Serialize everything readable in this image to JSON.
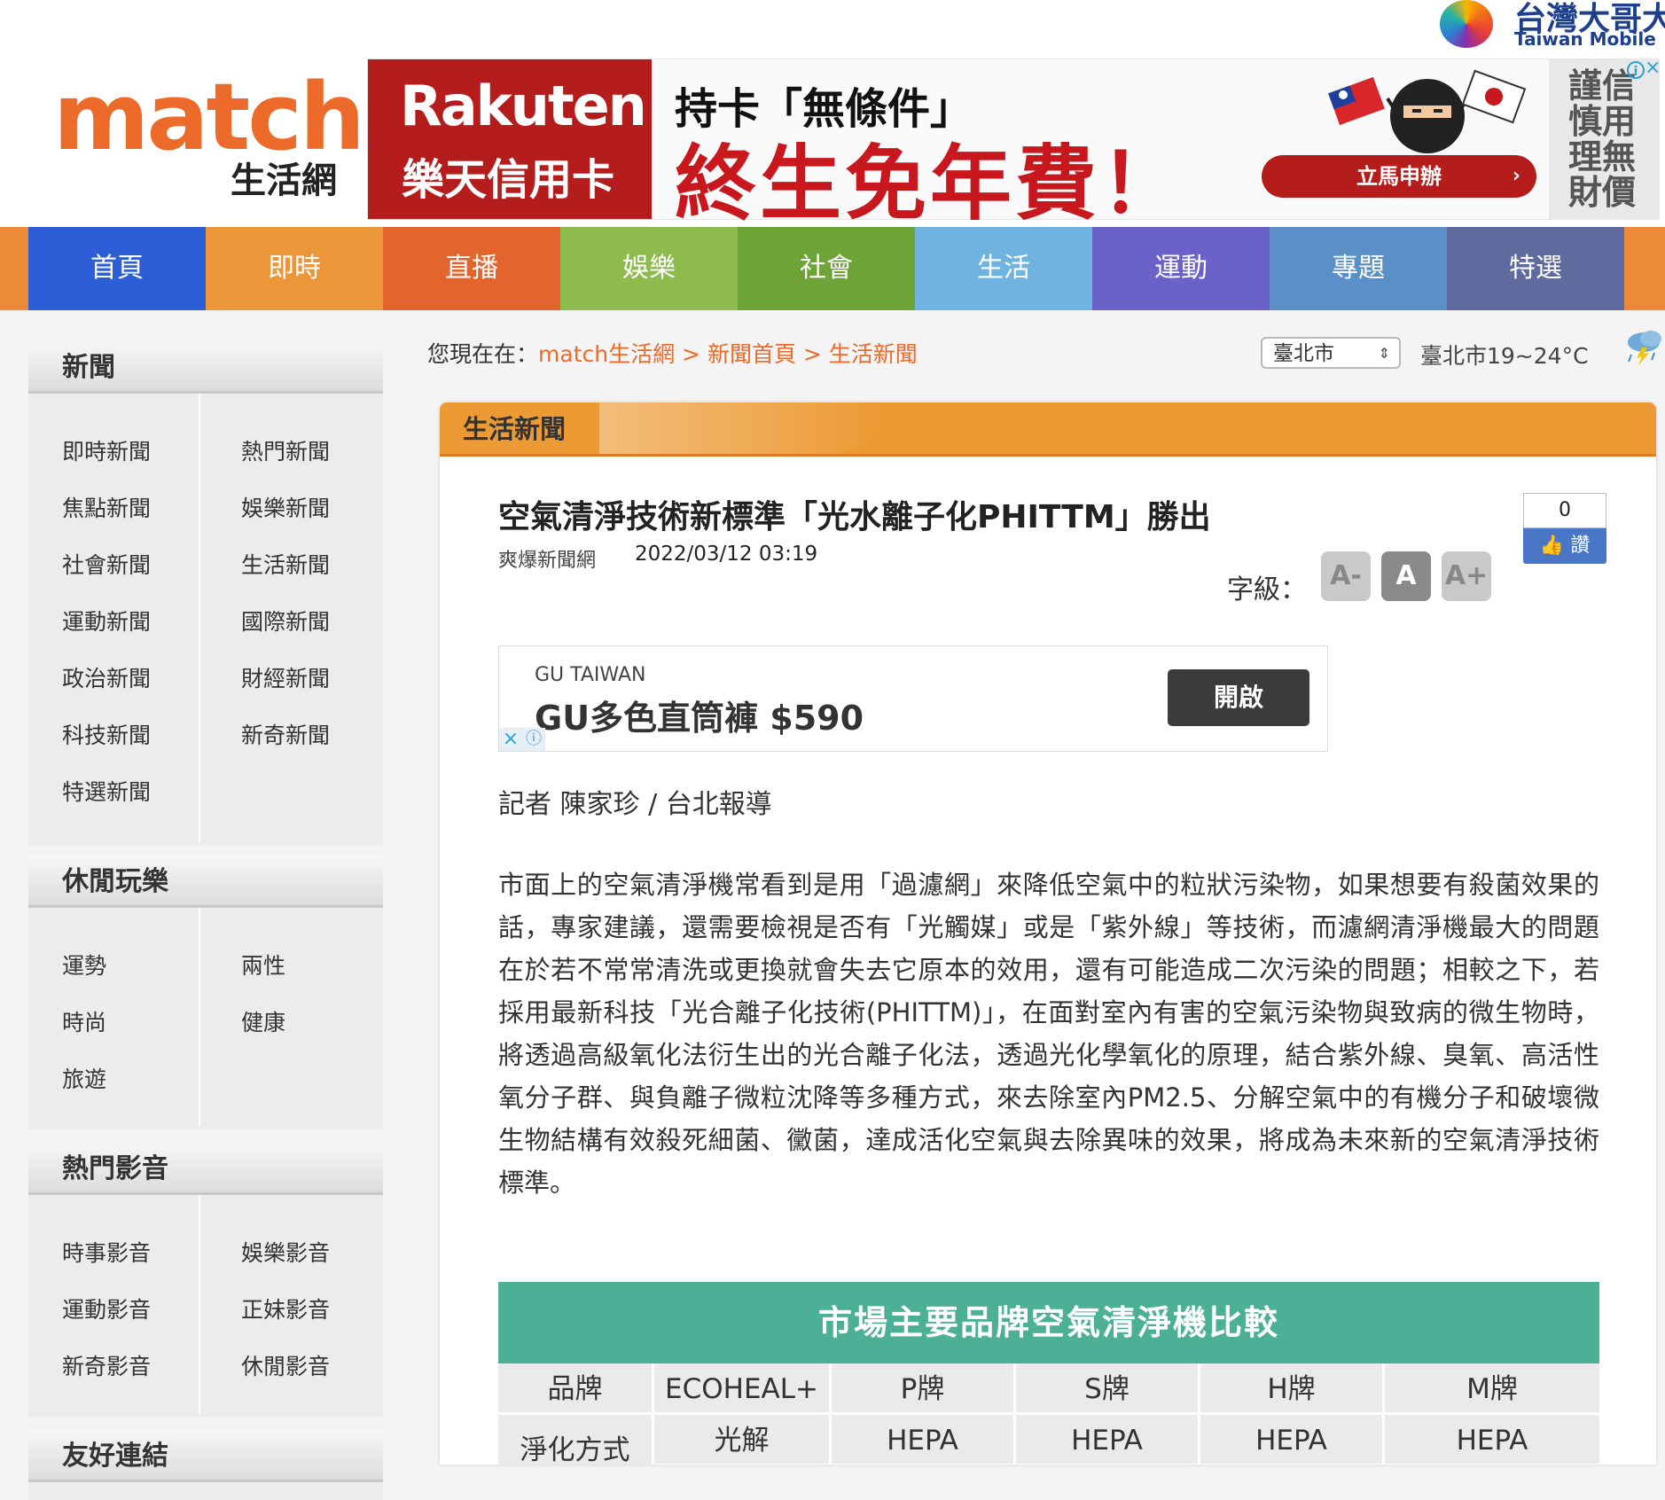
{
  "header": {
    "logo_text": "match",
    "logo_sub": "生活網",
    "partner_zh": "台灣大哥大",
    "partner_en": "Taiwan Mobile"
  },
  "ad_banner": {
    "brand_en": "Rakuten",
    "brand_zh": "樂天信用卡",
    "line1": "持卡「無條件」",
    "line2": "終生免年費！",
    "cta": "立馬申辦",
    "side_text": "謹信慎用理無財價"
  },
  "nav": {
    "items": [
      {
        "label": "首頁",
        "color": "#2d5ed8"
      },
      {
        "label": "即時",
        "color": "#ec963a"
      },
      {
        "label": "直播",
        "color": "#e3642c"
      },
      {
        "label": "娛樂",
        "color": "#8dbb4d"
      },
      {
        "label": "社會",
        "color": "#6ea337"
      },
      {
        "label": "生活",
        "color": "#6fb4e0"
      },
      {
        "label": "運動",
        "color": "#6a62c8"
      },
      {
        "label": "專題",
        "color": "#5b8fc8"
      },
      {
        "label": "特選",
        "color": "#5f6a9e"
      }
    ]
  },
  "sidebar": {
    "news": {
      "title": "新聞",
      "links": [
        "即時新聞",
        "熱門新聞",
        "焦點新聞",
        "娛樂新聞",
        "社會新聞",
        "生活新聞",
        "運動新聞",
        "國際新聞",
        "政治新聞",
        "財經新聞",
        "科技新聞",
        "新奇新聞",
        "特選新聞"
      ]
    },
    "leisure": {
      "title": "休閒玩樂",
      "links": [
        "運勢",
        "兩性",
        "時尚",
        "健康",
        "旅遊"
      ]
    },
    "video": {
      "title": "熱門影音",
      "links": [
        "時事影音",
        "娛樂影音",
        "運動影音",
        "正妹影音",
        "新奇影音",
        "休閒影音"
      ]
    },
    "friends": {
      "title": "友好連結"
    }
  },
  "breadcrumb": {
    "prefix": "您現在在：",
    "items": [
      "match生活網",
      "新聞首頁",
      "生活新聞"
    ],
    "sep": " > "
  },
  "weather": {
    "city": "臺北市",
    "text": "臺北市19~24°C"
  },
  "section": {
    "title": "生活新聞"
  },
  "article": {
    "title": "空氣清淨技術新標準「光水離子化PHITTM」勝出",
    "source": "爽爆新聞網",
    "date": "2022/03/12 03:19",
    "font_label": "字級：",
    "font_buttons": [
      "A-",
      "A",
      "A+"
    ],
    "like_count": "0",
    "like_label": "讚",
    "byline": "記者 陳家珍 / 台北報導",
    "body": "市面上的空氣清淨機常看到是用「過濾網」來降低空氣中的粒狀污染物，如果想要有殺菌效果的話，專家建議，還需要檢視是否有「光觸媒」或是「紫外線」等技術，而濾網清淨機最大的問題在於若不常常清洗或更換就會失去它原本的效用，還有可能造成二次污染的問題；相較之下，若採用最新科技「光合離子化技術(PHITTM)」，在面對室內有害的空氣污染物與致病的微生物時，將透過高級氧化法衍生出的光合離子化法，透過光化學氧化的原理，結合紫外線、臭氧、高活性氧分子群、與負離子微粒沈降等多種方式，來去除室內PM2.5、分解空氣中的有機分子和破壞微生物結構有效殺死細菌、黴菌，達成活化空氣與去除異味的效果，將成為未來新的空氣清淨技術標準。"
  },
  "inner_ad": {
    "brand": "GU TAIWAN",
    "title": "GU多色直筒褲 $590",
    "button": "開啟"
  },
  "comparison_table": {
    "title": "市場主要品牌空氣清淨機比較",
    "header": [
      "品牌",
      "ECOHEAL+",
      "P牌",
      "S牌",
      "H牌",
      "M牌"
    ],
    "row1": [
      "淨化方式",
      "光解",
      "HEPA",
      "HEPA",
      "HEPA",
      "HEPA"
    ]
  }
}
